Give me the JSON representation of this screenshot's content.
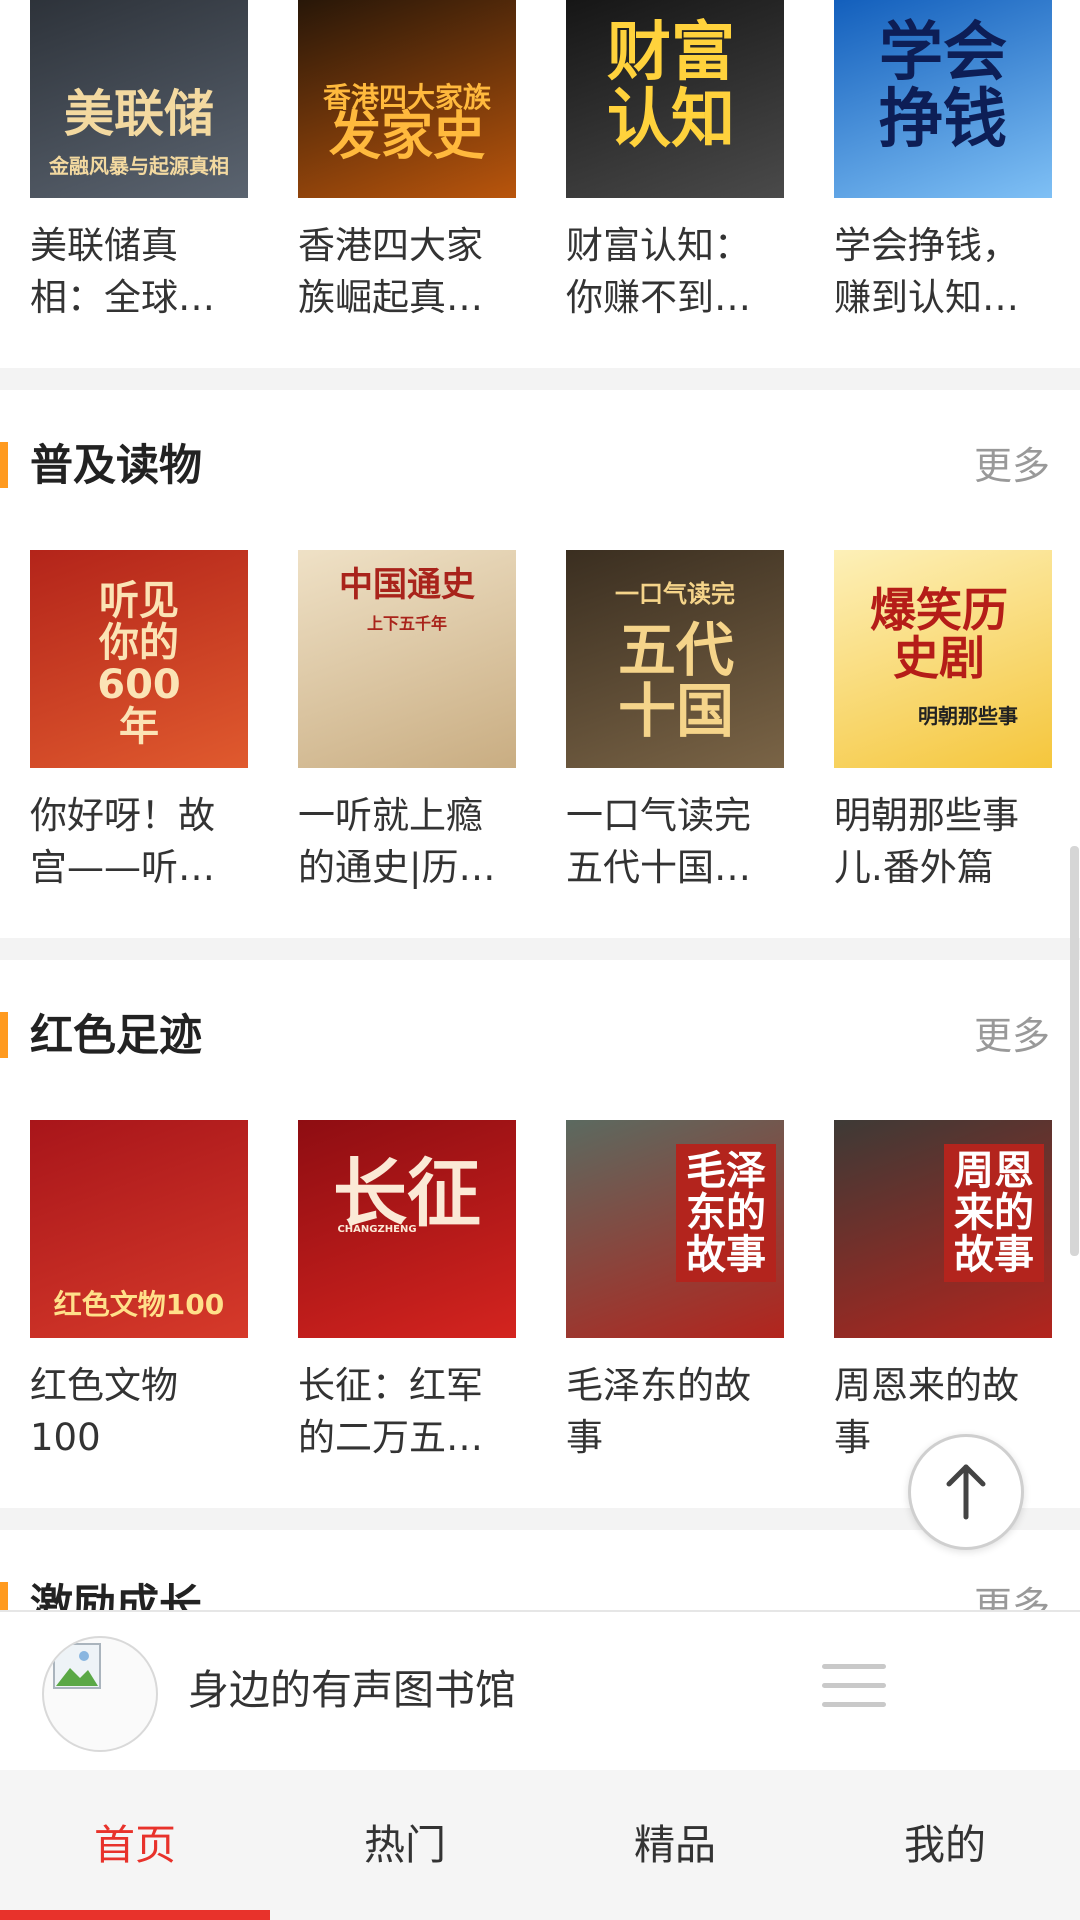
{
  "sections": [
    {
      "title": "",
      "more": "",
      "books": [
        {
          "title": "美联储真相：全球…",
          "cover_title": "美联储",
          "cover_sub": "金融风暴与起源真相",
          "cover_colors": [
            "#2a2f36",
            "#5b6470"
          ],
          "cover_text_color": "#f3d9a0"
        },
        {
          "title": "香港四大家族崛起真…",
          "cover_title": "发家史",
          "cover_sub": "香港四大家族",
          "cover_colors": [
            "#1d1208",
            "#b9550c"
          ],
          "cover_text_color": "#ffb93d"
        },
        {
          "title": "财富认知：你赚不到…",
          "cover_title": "财富认知",
          "cover_sub": "",
          "cover_colors": [
            "#121212",
            "#4a4a4a"
          ],
          "cover_text_color": "#ffd23c"
        },
        {
          "title": "学会挣钱，赚到认知…",
          "cover_title": "学会挣钱",
          "cover_sub": "",
          "cover_colors": [
            "#0b58b8",
            "#7fc0f5"
          ],
          "cover_text_color": "#0d1e56"
        }
      ]
    },
    {
      "title": "普及读物",
      "more": "更多",
      "books": [
        {
          "title": "你好呀！故宫——听…",
          "cover_title": "听见你的600年",
          "cover_sub": "",
          "cover_colors": [
            "#b3241a",
            "#e05a2e"
          ],
          "cover_text_color": "#fbe3b5"
        },
        {
          "title": "一听就上瘾的通史|历…",
          "cover_title": "中国通史",
          "cover_sub": "上下五千年",
          "cover_colors": [
            "#efe1c6",
            "#c9ad82"
          ],
          "cover_text_color": "#a9231b"
        },
        {
          "title": "一口气读完五代十国…",
          "cover_title": "五代十国",
          "cover_sub": "一口气读完",
          "cover_colors": [
            "#3a2e20",
            "#7a6446"
          ],
          "cover_text_color": "#f5d48a"
        },
        {
          "title": "明朝那些事儿.番外篇",
          "cover_title": "爆笑历史剧",
          "cover_sub": "明朝那些事",
          "cover_colors": [
            "#fdf0b8",
            "#f5c63c"
          ],
          "cover_text_color": "#b51d18"
        }
      ]
    },
    {
      "title": "红色足迹",
      "more": "更多",
      "books": [
        {
          "title": "红色文物100",
          "cover_title": "红色文物100",
          "cover_sub": "",
          "cover_colors": [
            "#a8151a",
            "#d63a2a"
          ],
          "cover_text_color": "#ffe08a"
        },
        {
          "title": "长征：红军的二万五…",
          "cover_title": "长征",
          "cover_sub": "CHANGZHENG",
          "cover_colors": [
            "#8e0d12",
            "#d4241f"
          ],
          "cover_text_color": "#fbe9d6"
        },
        {
          "title": "毛泽东的故事",
          "cover_title": "毛泽东的故事",
          "cover_sub": "",
          "cover_colors": [
            "#5b6a60",
            "#b3241d"
          ],
          "cover_text_color": "#ffffff"
        },
        {
          "title": "周恩来的故事",
          "cover_title": "周恩来的故事",
          "cover_sub": "",
          "cover_colors": [
            "#3d3a36",
            "#b3241d"
          ],
          "cover_text_color": "#ffffff"
        }
      ]
    },
    {
      "title": "激励成长",
      "more": "更多",
      "books": []
    }
  ],
  "player": {
    "title": "身边的有声图书馆"
  },
  "tabs": [
    {
      "label": "首页",
      "active": true
    },
    {
      "label": "热门",
      "active": false
    },
    {
      "label": "精品",
      "active": false
    },
    {
      "label": "我的",
      "active": false
    }
  ],
  "colors": {
    "accent": "#e8322b",
    "section_bar": "#ff9a1f"
  }
}
